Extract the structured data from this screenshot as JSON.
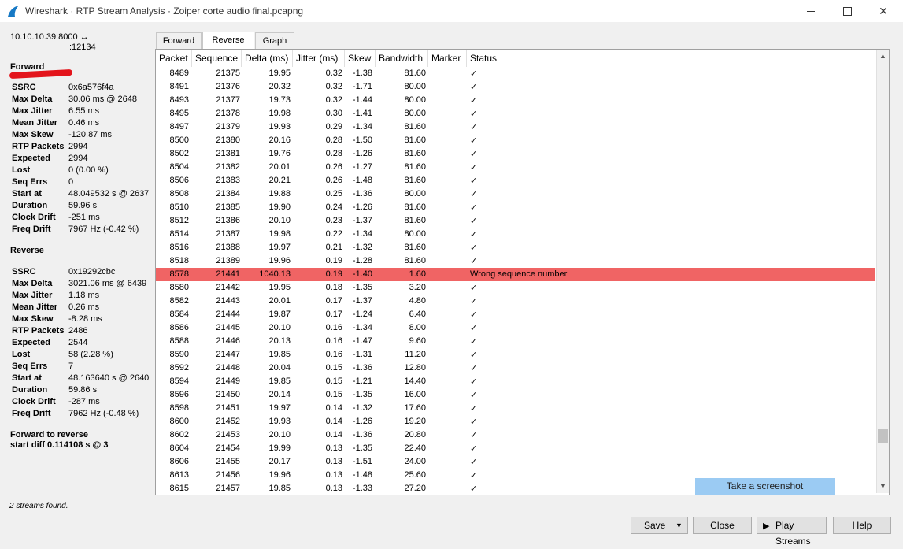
{
  "window": {
    "title": "Wireshark · RTP Stream Analysis · Zoiper corte audio final.pcapng"
  },
  "left_panel": {
    "stream_line1": "10.10.10.39:8000 ↔",
    "stream_line2_tail": ":12134",
    "forward_heading": "Forward",
    "forward_stats": [
      {
        "key": "SSRC",
        "value": "0x6a576f4a"
      },
      {
        "key": "Max Delta",
        "value": "30.06 ms @ 2648"
      },
      {
        "key": "Max Jitter",
        "value": "6.55 ms"
      },
      {
        "key": "Mean Jitter",
        "value": "0.46 ms"
      },
      {
        "key": "Max Skew",
        "value": "-120.87 ms"
      },
      {
        "key": "RTP Packets",
        "value": "2994"
      },
      {
        "key": "Expected",
        "value": "2994"
      },
      {
        "key": "Lost",
        "value": "0 (0.00 %)"
      },
      {
        "key": "Seq Errs",
        "value": "0"
      },
      {
        "key": "Start at",
        "value": "48.049532 s @ 2637"
      },
      {
        "key": "Duration",
        "value": "59.96 s"
      },
      {
        "key": "Clock Drift",
        "value": "-251 ms"
      },
      {
        "key": "Freq Drift",
        "value": "7967 Hz (-0.42 %)"
      }
    ],
    "reverse_heading": "Reverse",
    "reverse_stats": [
      {
        "key": "SSRC",
        "value": "0x19292cbc"
      },
      {
        "key": "Max Delta",
        "value": "3021.06 ms @ 6439"
      },
      {
        "key": "Max Jitter",
        "value": "1.18 ms"
      },
      {
        "key": "Mean Jitter",
        "value": "0.26 ms"
      },
      {
        "key": "Max Skew",
        "value": "-8.28 ms"
      },
      {
        "key": "RTP Packets",
        "value": "2486"
      },
      {
        "key": "Expected",
        "value": "2544"
      },
      {
        "key": "Lost",
        "value": "58 (2.28 %)"
      },
      {
        "key": "Seq Errs",
        "value": "7"
      },
      {
        "key": "Start at",
        "value": "48.163640 s @ 2640"
      },
      {
        "key": "Duration",
        "value": "59.86 s"
      },
      {
        "key": "Clock Drift",
        "value": "-287 ms"
      },
      {
        "key": "Freq Drift",
        "value": "7962 Hz (-0.48 %)"
      }
    ],
    "f2r_line1": "Forward to reverse",
    "f2r_line2": "start diff 0.114108 s @ 3",
    "streams_found": "2 streams found."
  },
  "tabs": [
    {
      "label": "Forward",
      "active": false
    },
    {
      "label": "Reverse",
      "active": true
    },
    {
      "label": "Graph",
      "active": false
    }
  ],
  "table": {
    "columns": [
      "Packet",
      "Sequence",
      "Delta (ms)",
      "Jitter (ms)",
      "Skew",
      "Bandwidth",
      "Marker",
      "Status"
    ],
    "error_color": "#f06464",
    "rows": [
      [
        "8489",
        "21375",
        "19.95",
        "0.32",
        "-1.38",
        "81.60",
        "",
        "✓"
      ],
      [
        "8491",
        "21376",
        "20.32",
        "0.32",
        "-1.71",
        "80.00",
        "",
        "✓"
      ],
      [
        "8493",
        "21377",
        "19.73",
        "0.32",
        "-1.44",
        "80.00",
        "",
        "✓"
      ],
      [
        "8495",
        "21378",
        "19.98",
        "0.30",
        "-1.41",
        "80.00",
        "",
        "✓"
      ],
      [
        "8497",
        "21379",
        "19.93",
        "0.29",
        "-1.34",
        "81.60",
        "",
        "✓"
      ],
      [
        "8500",
        "21380",
        "20.16",
        "0.28",
        "-1.50",
        "81.60",
        "",
        "✓"
      ],
      [
        "8502",
        "21381",
        "19.76",
        "0.28",
        "-1.26",
        "81.60",
        "",
        "✓"
      ],
      [
        "8504",
        "21382",
        "20.01",
        "0.26",
        "-1.27",
        "81.60",
        "",
        "✓"
      ],
      [
        "8506",
        "21383",
        "20.21",
        "0.26",
        "-1.48",
        "81.60",
        "",
        "✓"
      ],
      [
        "8508",
        "21384",
        "19.88",
        "0.25",
        "-1.36",
        "80.00",
        "",
        "✓"
      ],
      [
        "8510",
        "21385",
        "19.90",
        "0.24",
        "-1.26",
        "81.60",
        "",
        "✓"
      ],
      [
        "8512",
        "21386",
        "20.10",
        "0.23",
        "-1.37",
        "81.60",
        "",
        "✓"
      ],
      [
        "8514",
        "21387",
        "19.98",
        "0.22",
        "-1.34",
        "80.00",
        "",
        "✓"
      ],
      [
        "8516",
        "21388",
        "19.97",
        "0.21",
        "-1.32",
        "81.60",
        "",
        "✓"
      ],
      [
        "8518",
        "21389",
        "19.96",
        "0.19",
        "-1.28",
        "81.60",
        "",
        "✓"
      ],
      [
        "8578",
        "21441",
        "1040.13",
        "0.19",
        "-1.40",
        "1.60",
        "",
        "Wrong sequence number"
      ],
      [
        "8580",
        "21442",
        "19.95",
        "0.18",
        "-1.35",
        "3.20",
        "",
        "✓"
      ],
      [
        "8582",
        "21443",
        "20.01",
        "0.17",
        "-1.37",
        "4.80",
        "",
        "✓"
      ],
      [
        "8584",
        "21444",
        "19.87",
        "0.17",
        "-1.24",
        "6.40",
        "",
        "✓"
      ],
      [
        "8586",
        "21445",
        "20.10",
        "0.16",
        "-1.34",
        "8.00",
        "",
        "✓"
      ],
      [
        "8588",
        "21446",
        "20.13",
        "0.16",
        "-1.47",
        "9.60",
        "",
        "✓"
      ],
      [
        "8590",
        "21447",
        "19.85",
        "0.16",
        "-1.31",
        "11.20",
        "",
        "✓"
      ],
      [
        "8592",
        "21448",
        "20.04",
        "0.15",
        "-1.36",
        "12.80",
        "",
        "✓"
      ],
      [
        "8594",
        "21449",
        "19.85",
        "0.15",
        "-1.21",
        "14.40",
        "",
        "✓"
      ],
      [
        "8596",
        "21450",
        "20.14",
        "0.15",
        "-1.35",
        "16.00",
        "",
        "✓"
      ],
      [
        "8598",
        "21451",
        "19.97",
        "0.14",
        "-1.32",
        "17.60",
        "",
        "✓"
      ],
      [
        "8600",
        "21452",
        "19.93",
        "0.14",
        "-1.26",
        "19.20",
        "",
        "✓"
      ],
      [
        "8602",
        "21453",
        "20.10",
        "0.14",
        "-1.36",
        "20.80",
        "",
        "✓"
      ],
      [
        "8604",
        "21454",
        "19.99",
        "0.13",
        "-1.35",
        "22.40",
        "",
        "✓"
      ],
      [
        "8606",
        "21455",
        "20.17",
        "0.13",
        "-1.51",
        "24.00",
        "",
        "✓"
      ],
      [
        "8613",
        "21456",
        "19.96",
        "0.13",
        "-1.48",
        "25.60",
        "",
        "✓"
      ],
      [
        "8615",
        "21457",
        "19.85",
        "0.13",
        "-1.33",
        "27.20",
        "",
        "✓"
      ]
    ],
    "error_row_index": 15
  },
  "tooltip": "Take a screenshot",
  "buttons": {
    "save": "Save",
    "close": "Close",
    "play_streams": "Play Streams",
    "help": "Help"
  }
}
